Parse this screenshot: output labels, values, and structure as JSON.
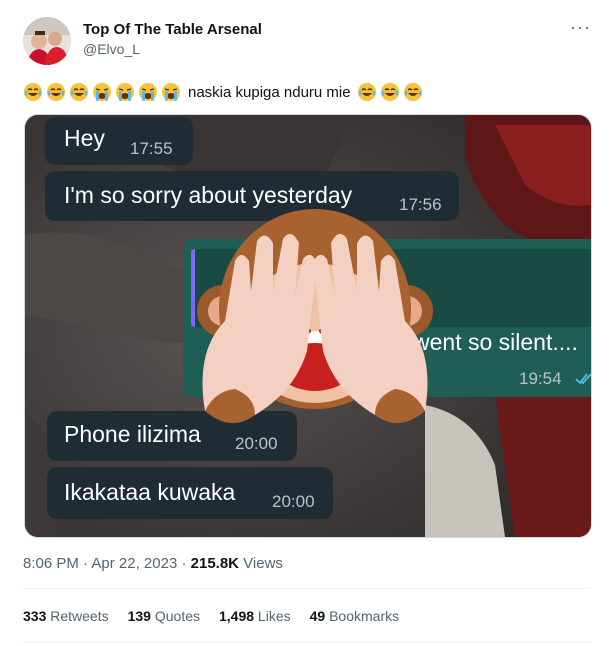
{
  "author": {
    "name": "Top Of The Table Arsenal",
    "handle": "@Elvo_L"
  },
  "more_label": "···",
  "tweet": {
    "leading_emojis": [
      "tears-of-joy",
      "tears-of-joy",
      "tears-of-joy",
      "loudly-crying",
      "loudly-crying",
      "loudly-crying",
      "loudly-crying"
    ],
    "text": "naskia kupiga nduru mie",
    "trailing_emojis": [
      "tears-of-joy",
      "tears-of-joy",
      "tears-of-joy"
    ]
  },
  "chat": {
    "messages": [
      {
        "text": "Hey",
        "time": "17:55",
        "side": "incoming"
      },
      {
        "text": "I'm so sorry about yesterday",
        "time": "17:56",
        "side": "incoming"
      },
      {
        "text": "went so silent....",
        "time": "19:54",
        "side": "outgoing",
        "status": "double-check-icon"
      },
      {
        "text": "Phone ilizima",
        "time": "20:00",
        "side": "incoming"
      },
      {
        "text": "Ikakataa kuwaka",
        "time": "20:00",
        "side": "incoming"
      }
    ],
    "overlay": "see-no-evil-monkey"
  },
  "meta": {
    "time": "8:06 PM",
    "sep1": " · ",
    "date": "Apr 22, 2023",
    "sep2": " · ",
    "views_count": "215.8K",
    "views_label": " Views"
  },
  "stats": {
    "retweets": {
      "count": "333",
      "label": " Retweets"
    },
    "quotes": {
      "count": "139",
      "label": " Quotes"
    },
    "likes": {
      "count": "1,498",
      "label": " Likes"
    },
    "bookmarks": {
      "count": "49",
      "label": " Bookmarks"
    }
  },
  "colors": {
    "incoming_bubble": "#1f2c34",
    "outgoing_bubble": "#1f5e55",
    "read_tick": "#53bdeb"
  }
}
